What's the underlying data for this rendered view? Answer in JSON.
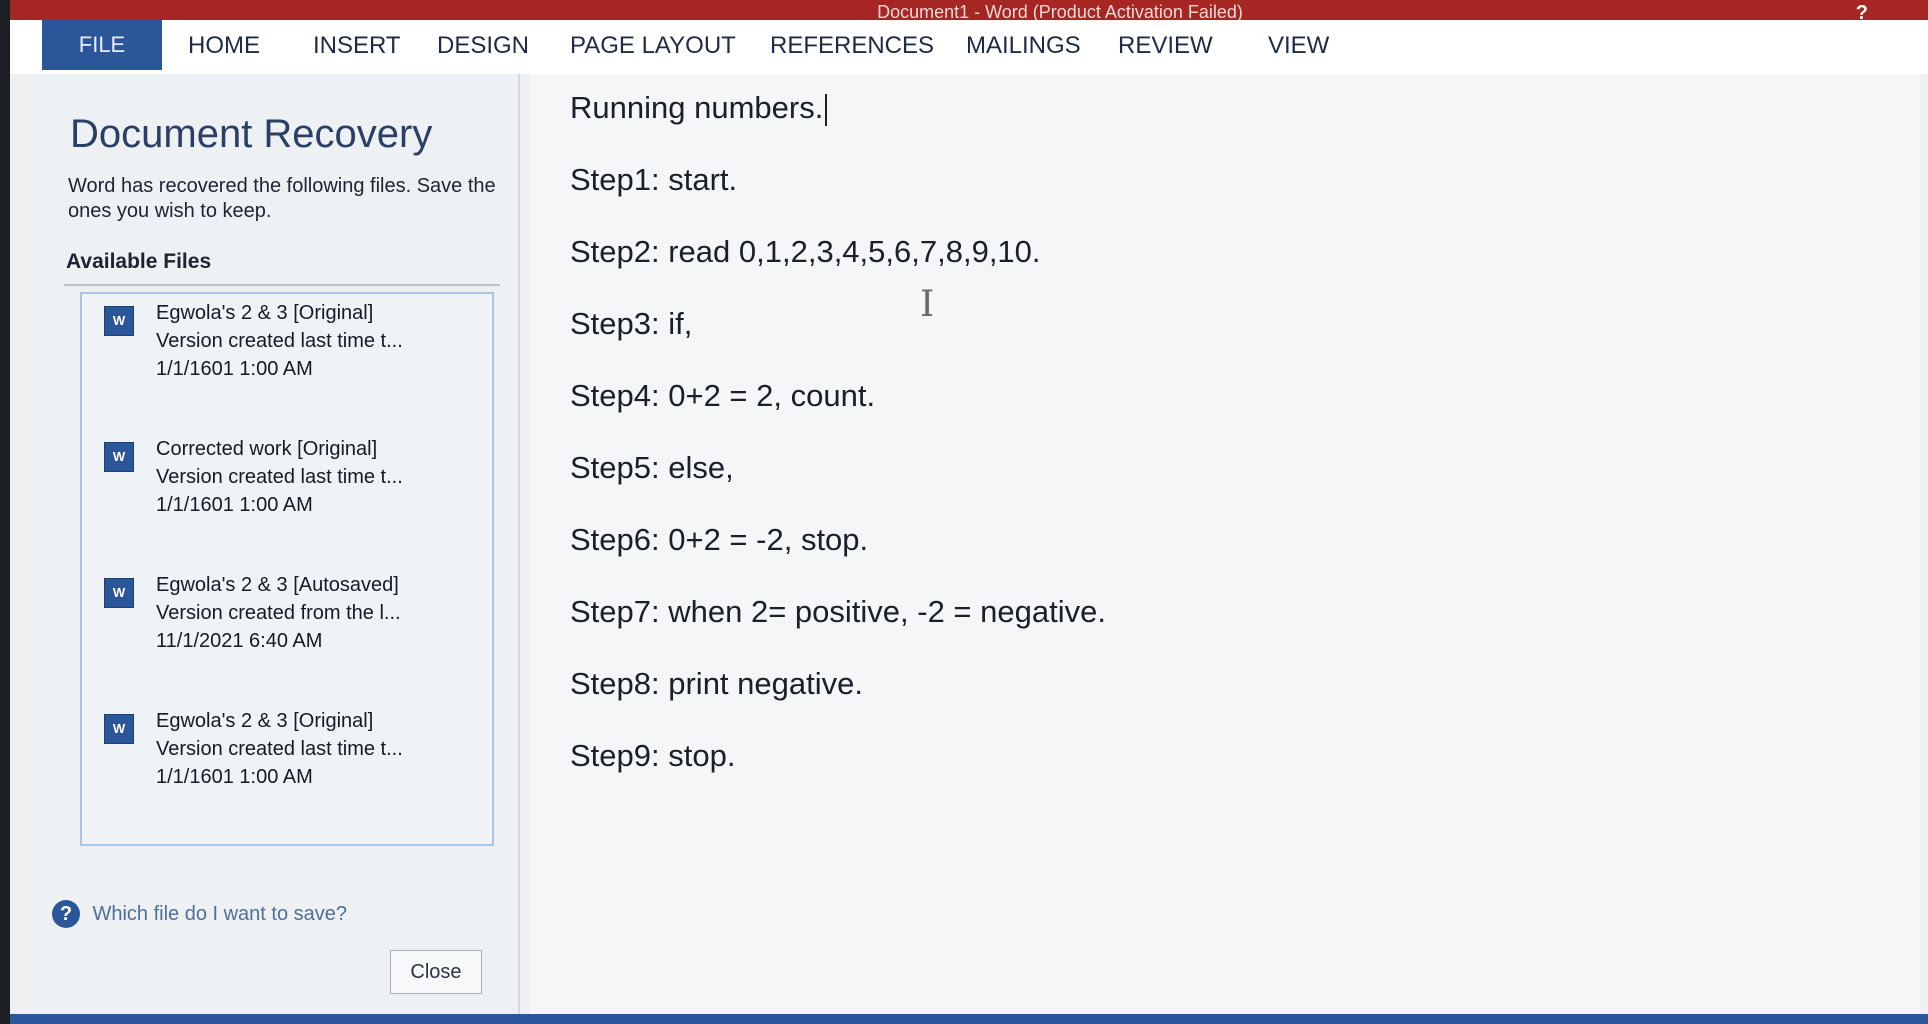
{
  "window": {
    "title": "Document1 - Word (Product Activation Failed)",
    "help": "?"
  },
  "ribbon": {
    "tabs": [
      "FILE",
      "HOME",
      "INSERT",
      "DESIGN",
      "PAGE LAYOUT",
      "REFERENCES",
      "MAILINGS",
      "REVIEW",
      "VIEW"
    ]
  },
  "recovery": {
    "heading": "Document Recovery",
    "description": "Word has recovered the following files. Save the ones you wish to keep.",
    "available_label": "Available Files",
    "files": [
      {
        "name": "Egwola's 2 & 3  [Original]",
        "detail": "Version created last time t...",
        "date": "1/1/1601 1:00 AM"
      },
      {
        "name": "Corrected work  [Original]",
        "detail": "Version created last time t...",
        "date": "1/1/1601 1:00 AM"
      },
      {
        "name": "Egwola's 2 & 3  [Autosaved]",
        "detail": "Version created from the l...",
        "date": "11/1/2021 6:40 AM"
      },
      {
        "name": "Egwola's 2 & 3  [Original]",
        "detail": "Version created last time t...",
        "date": "1/1/1601 1:00 AM"
      }
    ],
    "help_link": "Which file do I want to save?",
    "close_label": "Close"
  },
  "document": {
    "lines": [
      "Running numbers.",
      "Step1: start.",
      "Step2: read 0,1,2,3,4,5,6,7,8,9,10.",
      "Step3: if,",
      "Step4: 0+2 = 2, count.",
      "Step5: else,",
      "Step6: 0+2 = -2, stop.",
      "Step7: when 2= positive, -2 = negative.",
      "Step8: print negative.",
      "Step9: stop."
    ]
  },
  "icons": {
    "word_file": "W",
    "help": "?",
    "cursor": "I"
  },
  "colors": {
    "title_bar": "#a52622",
    "file_tab": "#2b579a",
    "word_blue": "#2b579a"
  }
}
